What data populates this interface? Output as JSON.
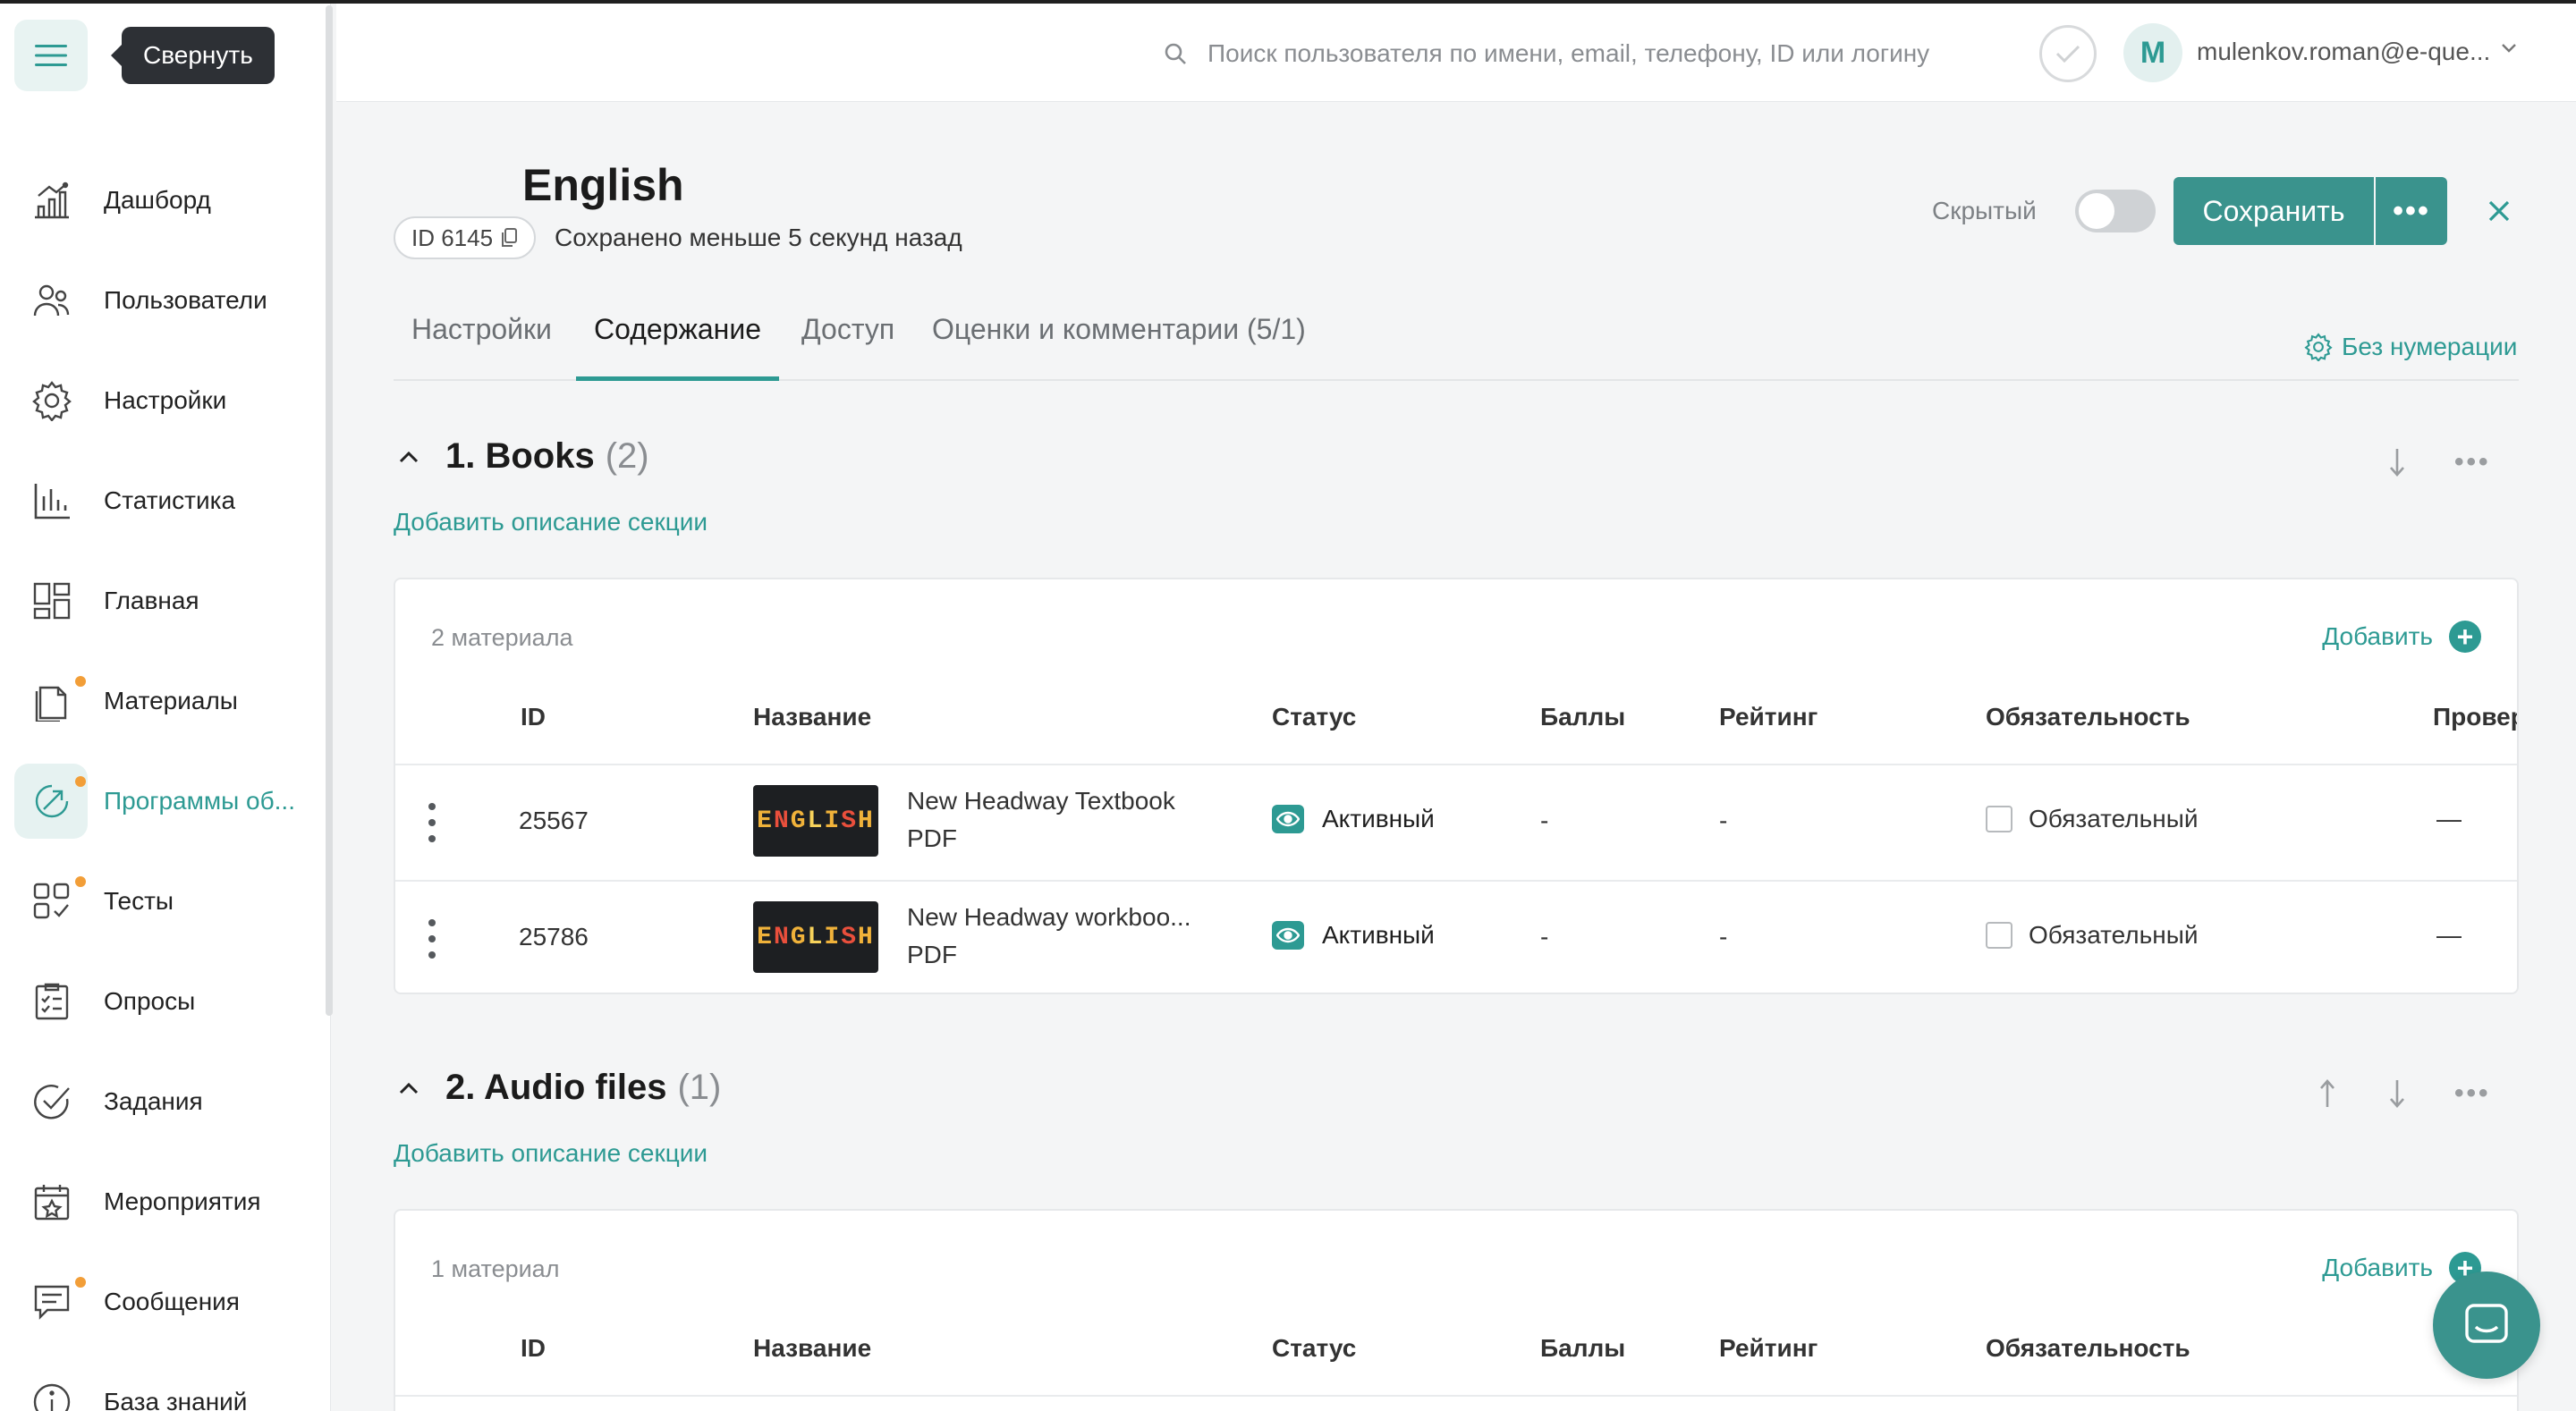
{
  "tooltip": "Свернуть",
  "sidebar": {
    "items": [
      {
        "label": "Дашборд",
        "icon": "dashboard-chart-icon"
      },
      {
        "label": "Пользователи",
        "icon": "users-icon"
      },
      {
        "label": "Настройки",
        "icon": "gear-icon"
      },
      {
        "label": "Статистика",
        "icon": "bar-chart-icon"
      },
      {
        "label": "Главная",
        "icon": "layout-grid-icon"
      },
      {
        "label": "Материалы",
        "icon": "documents-icon",
        "dot": true
      },
      {
        "label": "Программы об...",
        "icon": "program-arrow-icon",
        "dot": true,
        "active": true
      },
      {
        "label": "Тесты",
        "icon": "tests-grid-icon",
        "dot": true
      },
      {
        "label": "Опросы",
        "icon": "clipboard-checklist-icon"
      },
      {
        "label": "Задания",
        "icon": "check-circle-icon"
      },
      {
        "label": "Мероприятия",
        "icon": "calendar-star-icon"
      },
      {
        "label": "Сообщения",
        "icon": "message-icon",
        "dot": true
      },
      {
        "label": "База знаний",
        "icon": "info-icon"
      }
    ]
  },
  "header": {
    "search_placeholder": "Поиск пользователя по имени, email, телефону, ID или логину",
    "avatar_letter": "M",
    "user_email": "mulenkov.roman@e-que..."
  },
  "page": {
    "title": "English",
    "id_label": "ID 6145",
    "saved_text": "Сохранено меньше 5 секунд назад",
    "hidden_label": "Скрытый",
    "hidden_toggle_on": false,
    "save_label": "Сохранить",
    "more_label": "•••",
    "numbering_label": "Без нумерации"
  },
  "tabs": [
    {
      "label": "Настройки"
    },
    {
      "label": "Содержание",
      "active": true
    },
    {
      "label": "Доступ"
    },
    {
      "label": "Оценки и комментарии (5/1)"
    }
  ],
  "columns": {
    "id": "ID",
    "name": "Название",
    "status": "Статус",
    "points": "Баллы",
    "rating": "Рейтинг",
    "required": "Обязательность",
    "check": "Провер"
  },
  "sections": [
    {
      "title": "1. Books",
      "count": "(2)",
      "add_desc": "Добавить описание секции",
      "materials_count": "2 материала",
      "add_label": "Добавить",
      "rows": [
        {
          "id": "25567",
          "name": "New Headway Textbook",
          "type": "PDF",
          "status": "Активный",
          "points": "-",
          "rating": "-",
          "required": "Обязательный",
          "required_checked": false,
          "check": "—"
        },
        {
          "id": "25786",
          "name": "New Headway workboo...",
          "type": "PDF",
          "status": "Активный",
          "points": "-",
          "rating": "-",
          "required": "Обязательный",
          "required_checked": false,
          "check": "—"
        }
      ]
    },
    {
      "title": "2. Audio files",
      "count": "(1)",
      "add_desc": "Добавить описание секции",
      "materials_count": "1 материал",
      "add_label": "Добавить",
      "rows": []
    }
  ],
  "thumb_word": "ENGLISH",
  "colors": {
    "accent": "#2d9a93",
    "button": "#3a938d",
    "dot": "#f29e38"
  }
}
